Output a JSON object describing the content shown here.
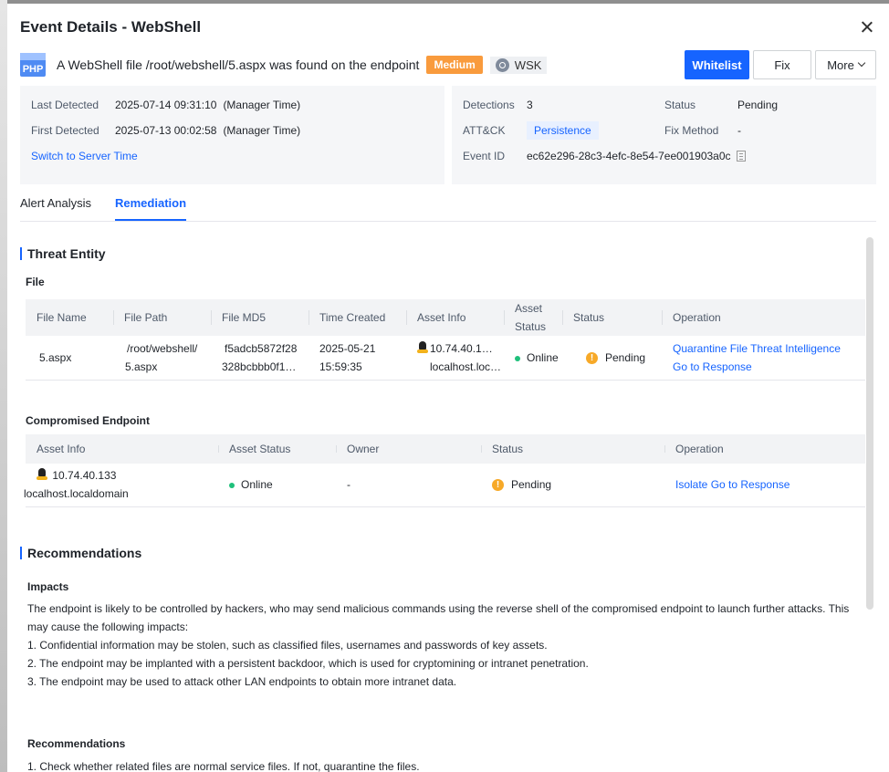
{
  "dialog": {
    "title": "Event Details - WebShell",
    "close_icon": "close-icon"
  },
  "summary": {
    "file_type_icon": "PHP",
    "description": "A WebShell file /root/webshell/5.aspx was found on the endpoint",
    "severity": "Medium",
    "tag": "WSK",
    "severity_color": "#f99b3d"
  },
  "actions": {
    "whitelist": "Whitelist",
    "fix": "Fix",
    "more": "More"
  },
  "info": {
    "last_detected_label": "Last Detected",
    "last_detected_value": "2025-07-14 09:31:10",
    "last_detected_suffix": "(Manager Time)",
    "first_detected_label": "First Detected",
    "first_detected_value": "2025-07-13 00:02:58",
    "first_detected_suffix": "(Manager Time)",
    "switch_link": "Switch to Server Time",
    "detections_label": "Detections",
    "detections_value": "3",
    "status_label": "Status",
    "status_value": "Pending",
    "attck_label": "ATT&CK",
    "attck_value": "Persistence",
    "fix_method_label": "Fix Method",
    "fix_method_value": "-",
    "event_id_label": "Event ID",
    "event_id_value": "ec62e296-28c3-4efc-8e54-7ee001903a0c"
  },
  "tabs": [
    {
      "label": "Alert Analysis",
      "active": false
    },
    {
      "label": "Remediation",
      "active": true
    }
  ],
  "threat_entity": {
    "title": "Threat Entity",
    "file_title": "File",
    "file_columns": [
      "File Name",
      "File Path",
      "File MD5",
      "Time Created",
      "Asset Info",
      "Asset Status",
      "Status",
      "Operation"
    ],
    "file_row": {
      "name": "5.aspx",
      "path_line1": "/root/webshell/",
      "path_line2": "5.aspx",
      "md5_line1": "f5adcb5872f28",
      "md5_line2": "328bcbbb0f1…",
      "time_line1": "2025-05-21",
      "time_line2": "15:59:35",
      "asset_line1": "10.74.40.1…",
      "asset_line2": "localhost.loc…",
      "asset_status": "Online",
      "status": "Pending",
      "op_quarantine": "Quarantine File",
      "op_ti": "Threat Intelligence",
      "op_response": "Go to Response"
    },
    "endpoint_title": "Compromised Endpoint",
    "endpoint_columns": [
      "Asset Info",
      "Asset Status",
      "Owner",
      "Status",
      "Operation"
    ],
    "endpoint_row": {
      "ip": "10.74.40.133",
      "host": "localhost.localdomain",
      "asset_status": "Online",
      "owner": "-",
      "status": "Pending",
      "op_isolate": "Isolate",
      "op_response": "Go to Response"
    }
  },
  "recommendations": {
    "title": "Recommendations",
    "impacts_title": "Impacts",
    "impacts_intro_1": "The endpoint is likely to be controlled by hackers, who may send malicious commands using the reverse shell of the compromised endpoint to launch further attacks. This",
    "impacts_intro_2": "may cause the following impacts:",
    "impact_1": "1. Confidential information may be stolen, such as classified files, usernames and passwords of key assets.",
    "impact_2": "2. The endpoint may be implanted with a persistent backdoor, which is used for cryptomining or intranet penetration.",
    "impact_3": "3. The endpoint may be used to attack other LAN endpoints to obtain more intranet data.",
    "rec_title": "Recommendations",
    "rec_1": "1. Check whether related files are normal service files. If not, quarantine the files."
  }
}
